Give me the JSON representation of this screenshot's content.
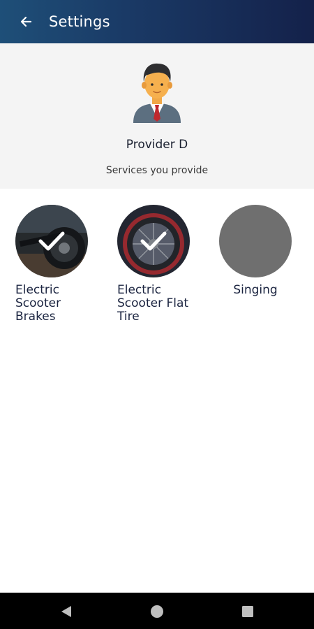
{
  "appbar": {
    "title": "Settings",
    "back_icon": "arrow-left-icon",
    "gradient_start": "#1e4f78",
    "gradient_end": "#14214a"
  },
  "profile": {
    "avatar_icon": "businessman-avatar-icon",
    "name": "Provider D",
    "caption": "Services you provide"
  },
  "services": [
    {
      "label": "Electric Scooter Brakes",
      "selected": true,
      "image": "electric-scooter-wheel-photo"
    },
    {
      "label": "Electric Scooter Flat Tire",
      "selected": true,
      "image": "bike-flat-tire-photo"
    },
    {
      "label": "Singing",
      "selected": false,
      "image": "grey-placeholder"
    }
  ],
  "navbar": {
    "back_icon": "triangle-back-icon",
    "home_icon": "circle-home-icon",
    "recents_icon": "square-recents-icon"
  }
}
